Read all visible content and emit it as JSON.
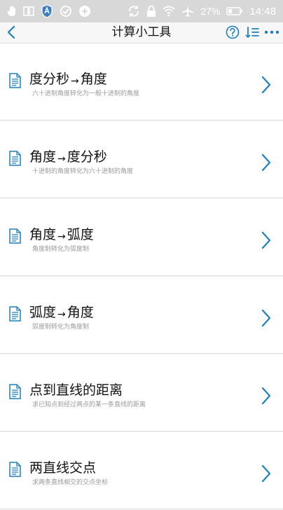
{
  "status_bar": {
    "battery_percent": "27%",
    "time": "14:48",
    "icons": [
      "hand-icon",
      "book-icon",
      "shield-app-icon",
      "sync-app-icon",
      "app-circle-icon",
      "sync-icon",
      "lock-icon",
      "wifi-off-icon",
      "airplane-icon",
      "battery-icon"
    ]
  },
  "header": {
    "title": "计算小工具",
    "icons": [
      "back-chevron-icon",
      "help-icon",
      "sort-list-icon",
      "more-dots-icon"
    ]
  },
  "accent_color": "#1f7fbd",
  "items": [
    {
      "title_a": "度分秒",
      "arrow": "→",
      "title_b": "角度",
      "subtitle": "六十进制角度转化为一般十进制的角度"
    },
    {
      "title_a": "角度",
      "arrow": "→",
      "title_b": "度分秒",
      "subtitle": "十进制的角度转化为六十进制的角度"
    },
    {
      "title_a": "角度",
      "arrow": "→",
      "title_b": "弧度",
      "subtitle": "角度制转化为弧度制"
    },
    {
      "title_a": "弧度",
      "arrow": "→",
      "title_b": "角度",
      "subtitle": "弧度制转化为角度制"
    },
    {
      "title_a": "点到直线的距离",
      "arrow": "",
      "title_b": "",
      "subtitle": "求已知点到经过两点的某一条直线的距离"
    },
    {
      "title_a": "两直线交点",
      "arrow": "",
      "title_b": "",
      "subtitle": "求两条直线相交的交点坐标"
    }
  ]
}
